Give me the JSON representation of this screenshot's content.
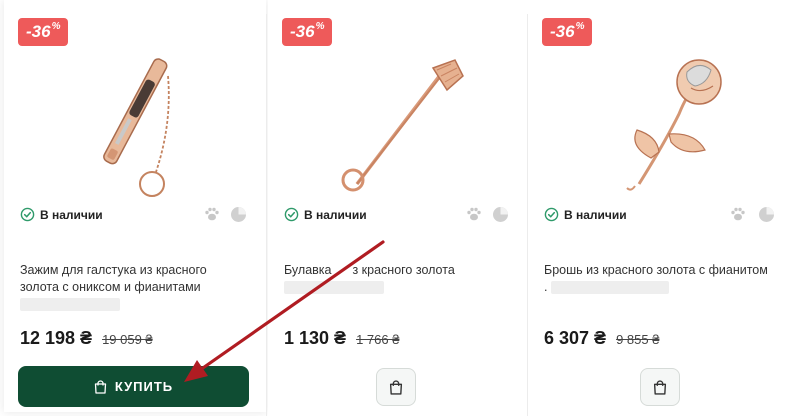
{
  "products": [
    {
      "discount": "-36",
      "discount_unit": "%",
      "stock": "В наличии",
      "title": "Зажим для галстука из красного золота с ониксом и фианитами",
      "price": "12 198 ₴",
      "old_price": "19 059 ₴",
      "buy_label": "КУПИТЬ",
      "image_icon": "tie-clip-icon"
    },
    {
      "discount": "-36",
      "discount_unit": "%",
      "stock": "В наличии",
      "title_start": "Булавка",
      "title_end": "з красного золота",
      "price": "1 130 ₴",
      "old_price": "1 766 ₴",
      "image_icon": "safety-pin-icon"
    },
    {
      "discount": "-36",
      "discount_unit": "%",
      "stock": "В наличии",
      "title": "Брошь из красного золота с фианитом .",
      "price": "6 307 ₴",
      "old_price": "9 855 ₴",
      "image_icon": "rose-brooch-icon"
    }
  ],
  "colors": {
    "badge": "#ee5a5a",
    "buy_button": "#0f4d33",
    "annotation_arrow": "#b01c22",
    "stock_check": "#2f9a6a"
  }
}
